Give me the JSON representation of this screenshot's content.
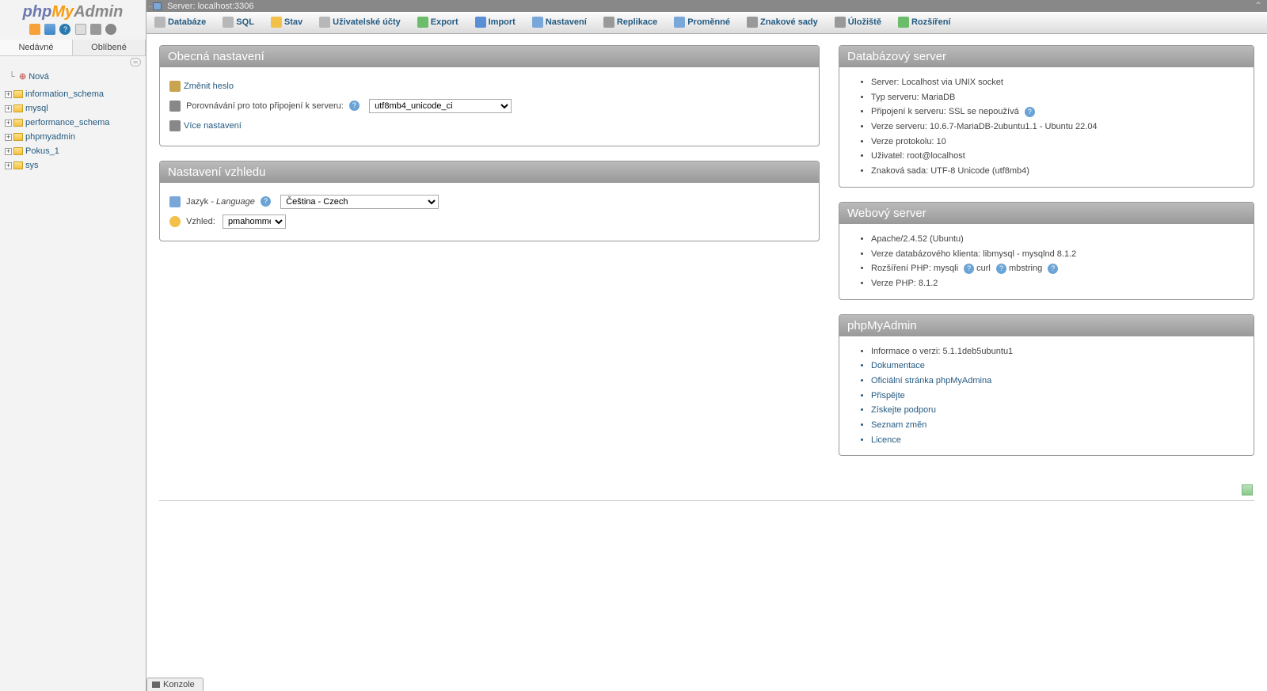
{
  "logo": {
    "php": "php",
    "my": "My",
    "admin": "Admin"
  },
  "shortcut_titles": {
    "home": "Home",
    "window": "Query window",
    "help": "Documentation",
    "docs": "phpMyAdmin documentation",
    "reload": "Reload",
    "cog": "Settings"
  },
  "nav_tabs": {
    "recent": "Nedávné",
    "favorite": "Oblíbené"
  },
  "collapse_label": "⟲",
  "tree": {
    "new": "Nová",
    "dbs": [
      "information_schema",
      "mysql",
      "performance_schema",
      "phpmyadmin",
      "Pokus_1",
      "sys"
    ]
  },
  "serverinfo": {
    "label": "Server: localhost:3306"
  },
  "topmenu": [
    {
      "k": "db",
      "label": "Databáze"
    },
    {
      "k": "sql",
      "label": "SQL"
    },
    {
      "k": "status",
      "label": "Stav"
    },
    {
      "k": "users",
      "label": "Uživatelské účty"
    },
    {
      "k": "export",
      "label": "Export"
    },
    {
      "k": "import",
      "label": "Import"
    },
    {
      "k": "settings",
      "label": "Nastavení"
    },
    {
      "k": "repl",
      "label": "Replikace"
    },
    {
      "k": "vars",
      "label": "Proměnné"
    },
    {
      "k": "charset",
      "label": "Znakové sady"
    },
    {
      "k": "engine",
      "label": "Úložiště"
    },
    {
      "k": "plugin",
      "label": "Rozšíření"
    }
  ],
  "general": {
    "title": "Obecná nastavení",
    "change_pw": "Změnit heslo",
    "collation_label": "Porovnávání pro toto připojení k serveru:",
    "collation_value": "utf8mb4_unicode_ci",
    "more": "Více nastavení"
  },
  "appearance": {
    "title": "Nastavení vzhledu",
    "lang_label": "Jazyk",
    "lang_label_en": " - Language",
    "lang_value": "Čeština - Czech",
    "theme_label": "Vzhled:",
    "theme_value": "pmahomme"
  },
  "dbserver": {
    "title": "Databázový server",
    "items": [
      "Server: Localhost via UNIX socket",
      "Typ serveru: MariaDB",
      "Připojení k serveru: SSL se nepoužívá",
      "Verze serveru: 10.6.7-MariaDB-2ubuntu1.1 - Ubuntu 22.04",
      "Verze protokolu: 10",
      "Uživatel: root@localhost",
      "Znaková sada: UTF-8 Unicode (utf8mb4)"
    ],
    "ssl_help_index": 2
  },
  "webserver": {
    "title": "Webový server",
    "items": [
      "Apache/2.4.52 (Ubuntu)",
      "Verze databázového klienta: libmysql - mysqlnd 8.1.2"
    ],
    "php_ext_label": "Rozšíření PHP:",
    "php_ext": [
      "mysqli",
      "curl",
      "mbstring"
    ],
    "php_ver": "Verze PHP: 8.1.2"
  },
  "pma": {
    "title": "phpMyAdmin",
    "version": "Informace o verzi: 5.1.1deb5ubuntu1",
    "links": [
      "Dokumentace",
      "Oficiální stránka phpMyAdmina",
      "Přispějte",
      "Získejte podporu",
      "Seznam změn",
      "Licence"
    ]
  },
  "console": "Konzole"
}
